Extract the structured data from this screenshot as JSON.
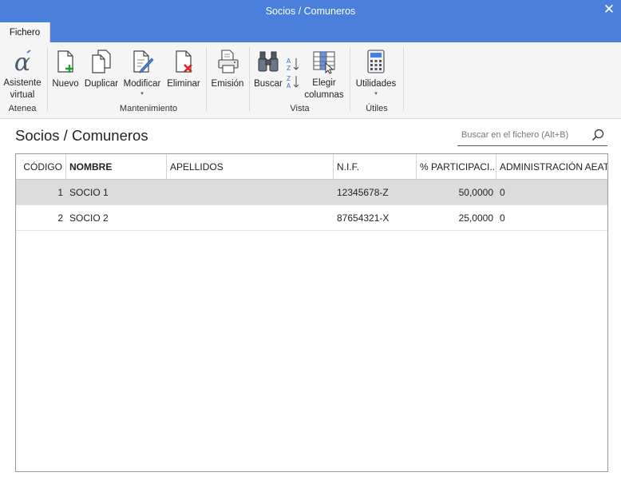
{
  "window": {
    "title": "Socios / Comuneros",
    "close_glyph": "✕"
  },
  "tabs": [
    {
      "label": "Fichero",
      "active": true
    }
  ],
  "ribbon": {
    "groups": [
      {
        "label": "Atenea"
      },
      {
        "label": "Mantenimiento"
      },
      {
        "label": "Vista"
      },
      {
        "label": "Útiles"
      }
    ],
    "buttons": {
      "asistente": {
        "line1": "Asistente",
        "line2": "virtual",
        "icon": "alpha-assistant-icon"
      },
      "nuevo": {
        "label": "Nuevo",
        "icon": "new-document-icon"
      },
      "duplicar": {
        "label": "Duplicar",
        "icon": "duplicate-document-icon"
      },
      "modificar": {
        "label": "Modificar",
        "icon": "edit-document-icon",
        "dropdown": "▾"
      },
      "eliminar": {
        "label": "Eliminar",
        "icon": "delete-document-icon"
      },
      "emision": {
        "label": "Emisión",
        "icon": "print-icon"
      },
      "buscar": {
        "label": "Buscar",
        "icon": "binoculars-icon"
      },
      "elegir": {
        "line1": "Elegir",
        "line2": "columnas",
        "icon": "choose-columns-icon"
      },
      "utilidades": {
        "label": "Utilidades",
        "icon": "calculator-icon",
        "dropdown": "▾"
      }
    }
  },
  "colors": {
    "accent": "#4a7fdc",
    "ribbon_bg": "#f5f5f5",
    "selected_row": "#dcdcdc",
    "delete_red": "#e02020",
    "new_green": "#1fa035"
  },
  "page": {
    "title": "Socios / Comuneros",
    "search": {
      "placeholder": "Buscar en el fichero (Alt+B)",
      "value": ""
    }
  },
  "table": {
    "columns": [
      "CÓDIGO",
      "NOMBRE",
      "APELLIDOS",
      "N.I.F.",
      "% PARTICIPACI...",
      "ADMINISTRACIÓN AEAT"
    ],
    "sort_column": "NOMBRE",
    "rows": [
      {
        "codigo": "1",
        "nombre": "SOCIO 1",
        "apellidos": "",
        "nif": "12345678-Z",
        "participacion": "50,0000",
        "aeat": "0",
        "selected": true
      },
      {
        "codigo": "2",
        "nombre": "SOCIO 2",
        "apellidos": "",
        "nif": "87654321-X",
        "participacion": "25,0000",
        "aeat": "0",
        "selected": false
      }
    ]
  }
}
